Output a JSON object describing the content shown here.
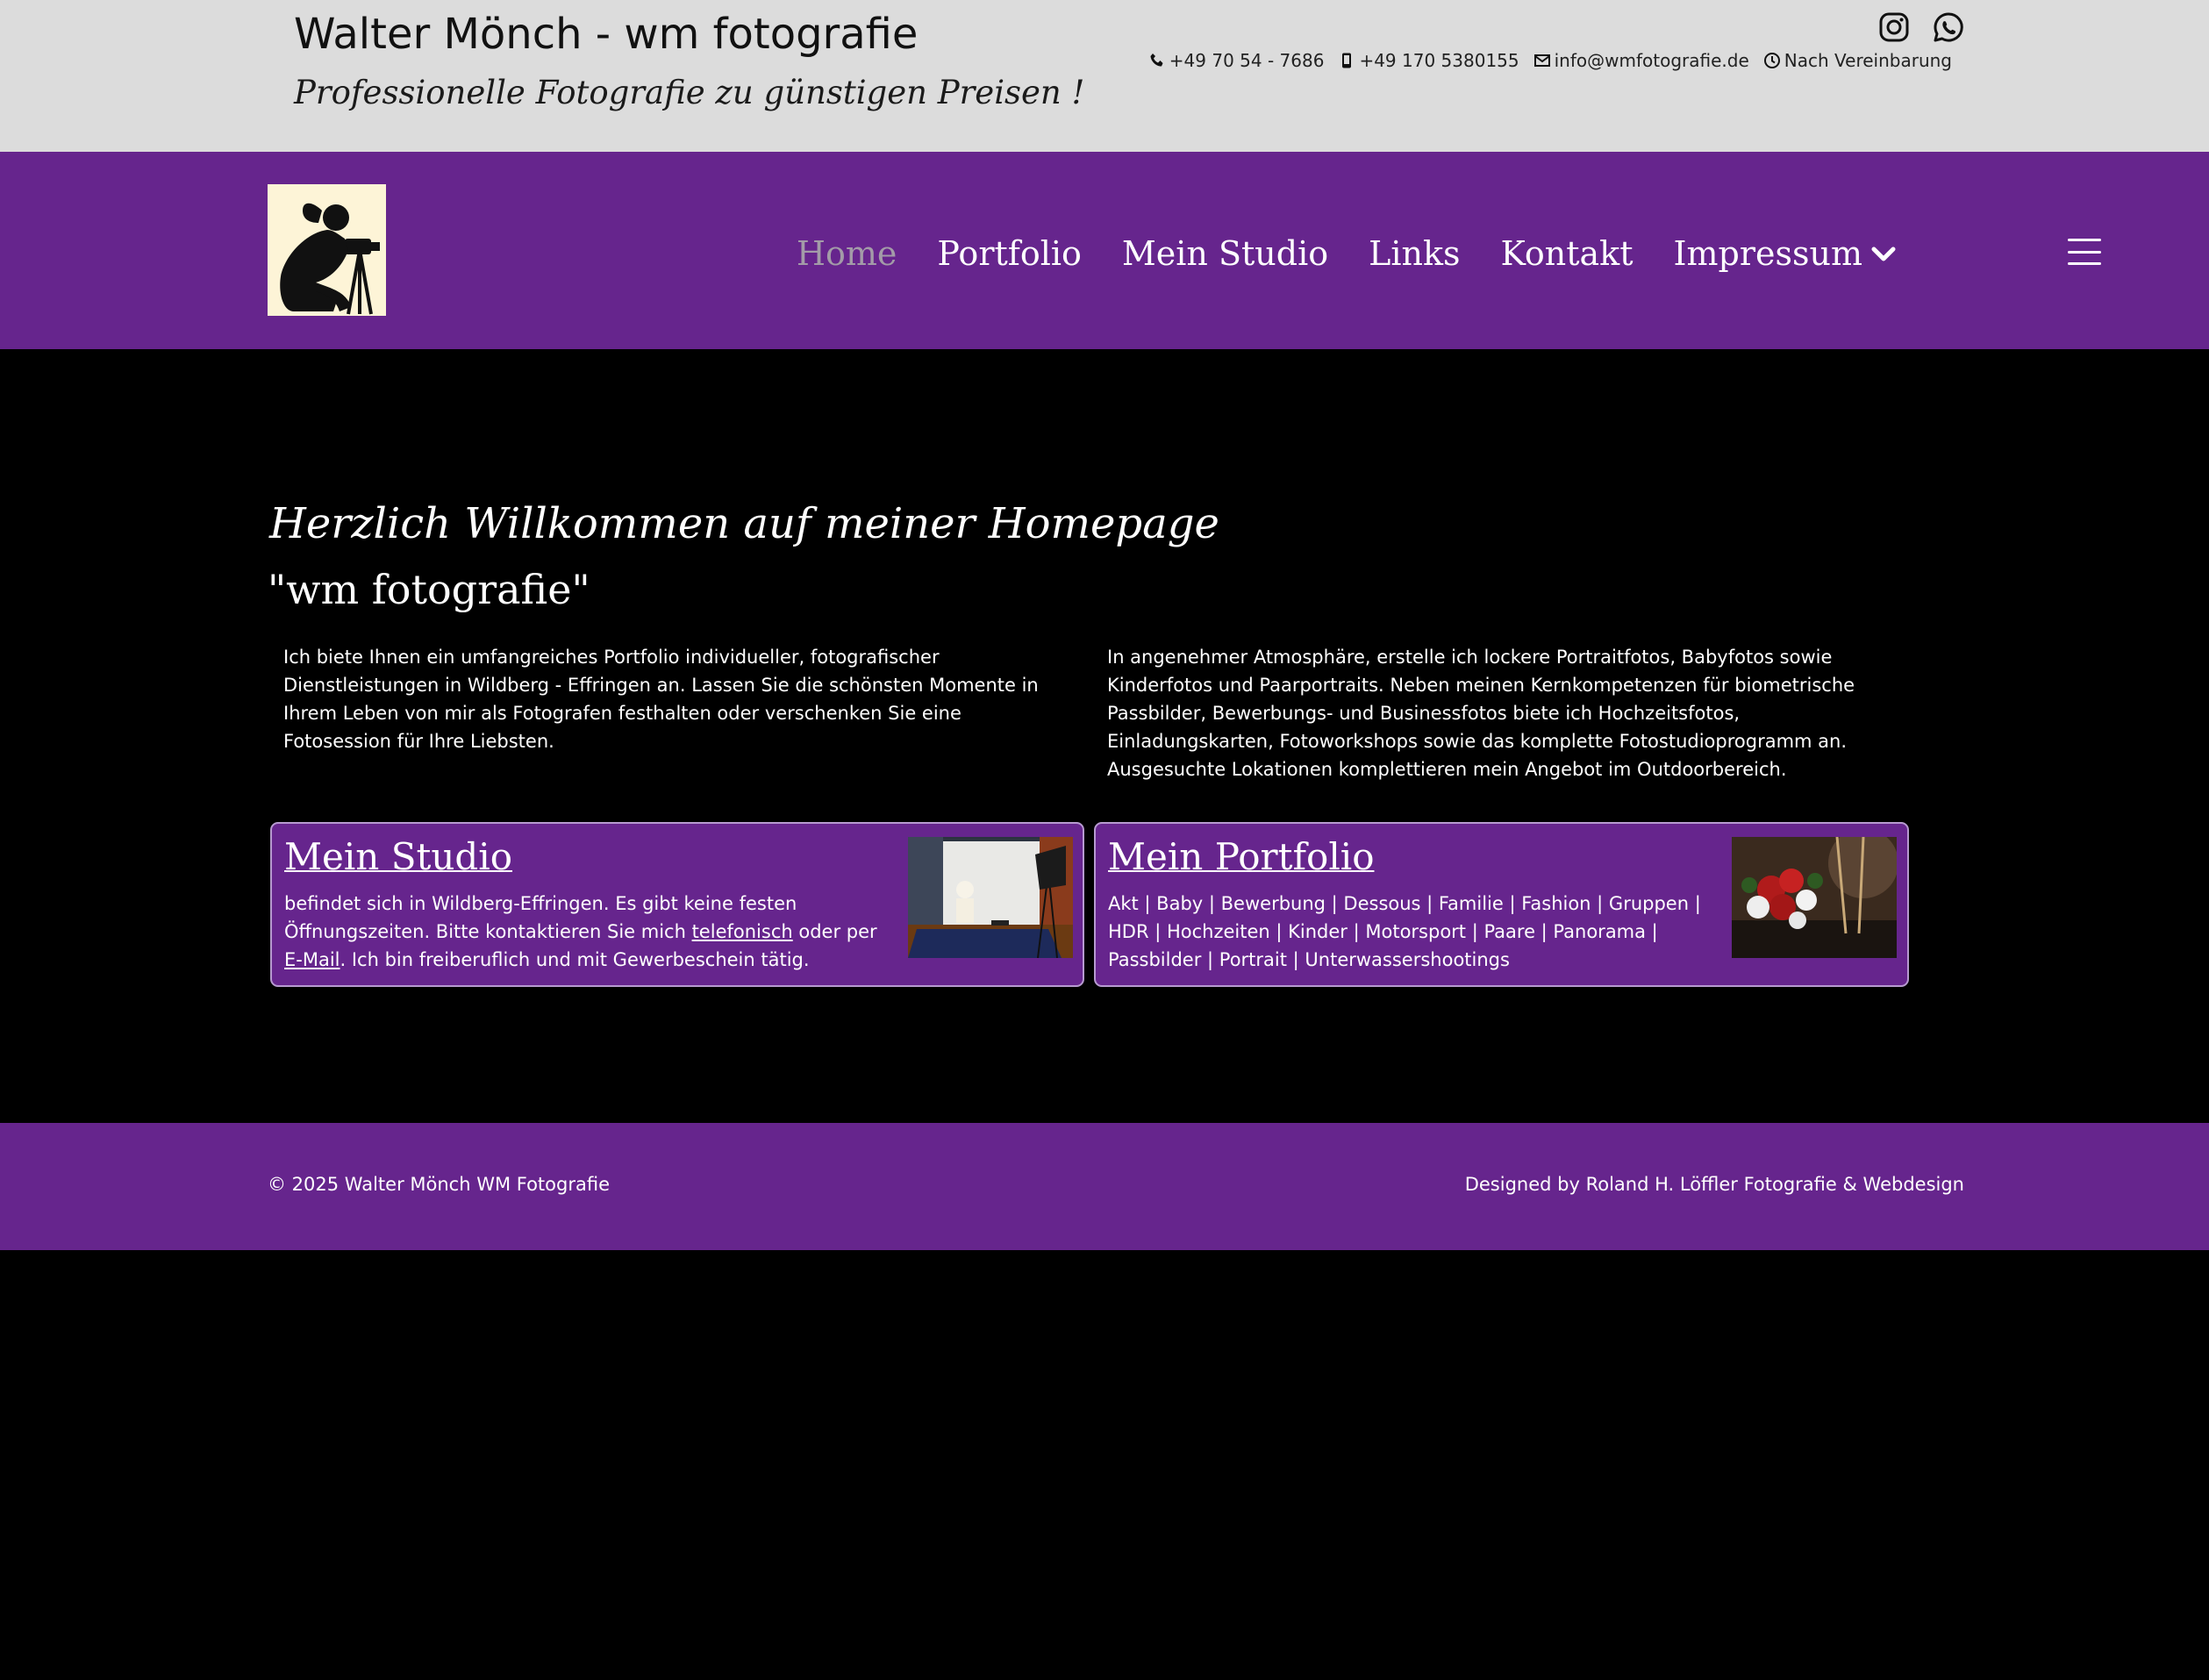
{
  "header": {
    "title": "Walter Mönch - wm fotografie",
    "tagline": "Professionelle Fotografie zu günstigen Preisen !",
    "social": [
      "instagram-icon",
      "whatsapp-icon"
    ],
    "contacts": {
      "phone": "+49 70 54 - 7686",
      "mobile": "+49 170 5380155",
      "email": "info@wmfotografie.de",
      "hours": "Nach Vereinbarung"
    }
  },
  "nav": {
    "items": [
      {
        "label": "Home",
        "active": true
      },
      {
        "label": "Portfolio"
      },
      {
        "label": "Mein Studio"
      },
      {
        "label": "Links"
      },
      {
        "label": "Kontakt"
      },
      {
        "label": "Impressum"
      }
    ],
    "menu_icon": "hamburger-menu-icon"
  },
  "main": {
    "welcome": "Herzlich Willkommen auf meiner Homepage",
    "brand": "\"wm fotografie\"",
    "intro_left": "Ich biete Ihnen ein umfangreiches Portfolio individueller, fotografischer Dienstleistungen in Wildberg - Effringen an. Lassen Sie die schönsten Momente in Ihrem Leben von mir als Fotografen festhalten oder verschenken Sie eine Fotosession für Ihre Liebsten.",
    "intro_right": "In angenehmer Atmosphäre, erstelle ich lockere Portraitfotos, Babyfotos sowie Kinderfotos und Paarportraits. Neben meinen Kernkompetenzen für biometrische Passbilder, Bewerbungs- und Businessfotos biete ich Hochzeitsfotos, Einladungskarten, Fotoworkshops sowie das komplette Fotostudioprogramm an. Ausgesuchte Lokationen komplettieren mein Angebot im Outdoorbereich.",
    "studio_card": {
      "title": "Mein Studio",
      "text_1": "befindet sich in Wildberg-Effringen. Es gibt keine festen Öffnungszeiten. Bitte kontaktieren Sie mich ",
      "link_phone": "telefonisch",
      "text_2": " oder per ",
      "link_email": "E-Mail",
      "text_3": ". Ich bin freiberuflich und mit Gewerbeschein tätig."
    },
    "portfolio_card": {
      "title": "Mein Portfolio",
      "text": "Akt | Baby | Bewerbung | Dessous | Familie | Fashion | Gruppen | HDR | Hochzeiten | Kinder | Motorsport | Paare | Panorama | Passbilder | Portrait | Unterwassershootings"
    }
  },
  "footer": {
    "copyright": "© 2025 Walter Mönch WM Fotografie",
    "designed_by": "Designed by Roland H. Löffler Fotografie & Webdesign"
  },
  "colors": {
    "purple": "#66258d",
    "header_gray": "#dcdcdc",
    "background": "#000000"
  }
}
